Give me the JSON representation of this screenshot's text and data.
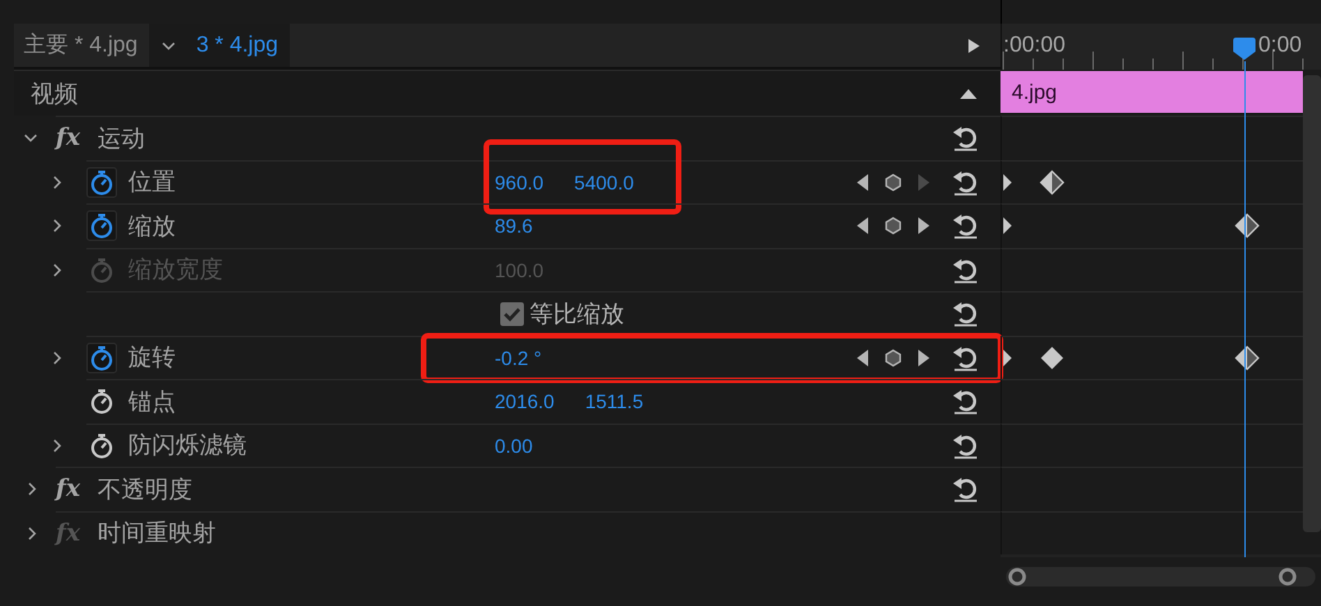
{
  "tabs": [
    {
      "label": "主要 * 4.jpg",
      "selected": false,
      "menu": false
    },
    {
      "label": "3 * 4.jpg",
      "selected": true,
      "menu": true
    }
  ],
  "ruler": {
    "start": ":00:00",
    "end": "0:00"
  },
  "clip": {
    "name": "4.jpg"
  },
  "section": {
    "label": "视频",
    "expanded": true
  },
  "effects": [
    {
      "badge": "fx",
      "name": "运动",
      "enabled": true,
      "expanded": true,
      "reset": true,
      "children": [
        {
          "kind": "property",
          "name": "位置",
          "expandable": true,
          "animated": true,
          "disabled": false,
          "values": [
            "960.0",
            "5400.0"
          ],
          "highlight": {
            "kind": "values"
          },
          "keyframe_nav": true,
          "next_enabled": false,
          "keyframes": [
            {
              "kind": "half",
              "at_playhead": false
            }
          ]
        },
        {
          "kind": "property",
          "name": "缩放",
          "expandable": true,
          "animated": true,
          "disabled": false,
          "values": [
            "89.6"
          ],
          "keyframe_nav": true,
          "next_enabled": true,
          "keyframes": [
            {
              "kind": "half",
              "at_playhead": true
            }
          ]
        },
        {
          "kind": "property",
          "name": "缩放宽度",
          "expandable": true,
          "animated": false,
          "disabled": true,
          "values": [
            "100.0"
          ],
          "keyframe_nav": false
        },
        {
          "kind": "checkbox",
          "label": "等比缩放",
          "checked": true
        },
        {
          "kind": "property",
          "name": "旋转",
          "expandable": true,
          "animated": true,
          "disabled": false,
          "values": [
            "-0.2 °"
          ],
          "highlight": {
            "kind": "row"
          },
          "keyframe_nav": true,
          "next_enabled": true,
          "keyframes": [
            {
              "kind": "full",
              "at_playhead": false
            },
            {
              "kind": "half",
              "at_playhead": true
            }
          ]
        },
        {
          "kind": "property",
          "name": "锚点",
          "expandable": false,
          "animated": false,
          "disabled": false,
          "values": [
            "2016.0",
            "1511.5"
          ],
          "keyframe_nav": false
        },
        {
          "kind": "property",
          "name": "防闪烁滤镜",
          "expandable": true,
          "animated": false,
          "disabled": false,
          "values": [
            "0.00"
          ],
          "keyframe_nav": false
        }
      ]
    },
    {
      "badge": "fx",
      "name": "不透明度",
      "enabled": true,
      "expanded": false,
      "reset": true
    },
    {
      "badge": "fx",
      "name": "时间重映射",
      "enabled": false,
      "expanded": false,
      "reset": false
    }
  ]
}
